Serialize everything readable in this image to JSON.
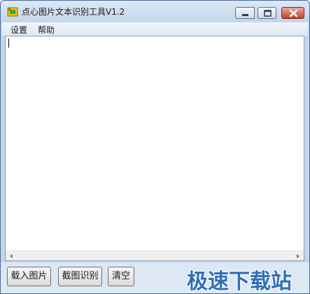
{
  "window": {
    "title": "点心图片文本识别工具V1.2"
  },
  "menu": {
    "items": [
      {
        "label": "设置"
      },
      {
        "label": "帮助"
      }
    ]
  },
  "editor": {
    "value": ""
  },
  "buttons": {
    "load_image": "载入图片",
    "capture_recognize": "截图识别",
    "clear": "清空"
  },
  "watermark": {
    "text": "极速下载站"
  },
  "colors": {
    "title_bar": "#c3d6ec",
    "close_button": "#c6412b",
    "watermark": "#2f6eb8",
    "frame": "#c4d6ea"
  },
  "icons": {
    "app": "app-logo-icon",
    "minimize": "minimize-icon",
    "maximize": "maximize-icon",
    "close": "close-icon",
    "scroll_left": "scroll-left-arrow-icon",
    "scroll_right": "scroll-right-arrow-icon"
  }
}
